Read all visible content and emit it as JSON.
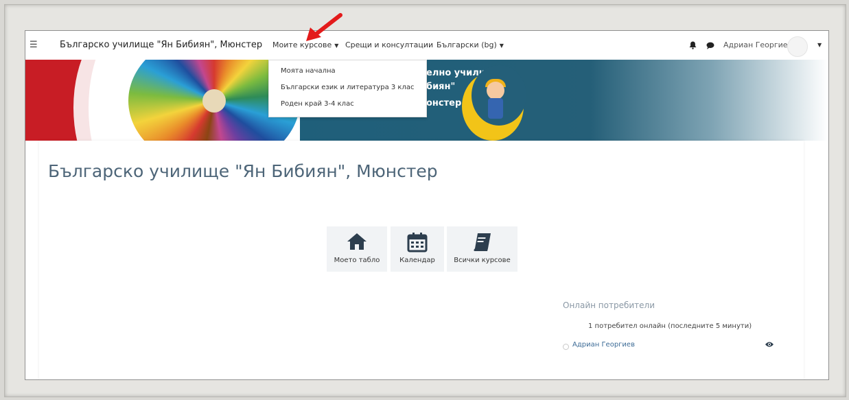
{
  "navbar": {
    "brand": "Българско училище \"Ян Бибиян\", Мюнстер",
    "menu_courses": "Моите курсове",
    "menu_meetings": "Срещи и консултации",
    "menu_language": "Български (bg)",
    "user_name": "Адриан Георгиев"
  },
  "dropdown": {
    "items": [
      "Моята начална",
      "Български език и литература 3 клас",
      "Роден край 3-4 клас"
    ]
  },
  "banner": {
    "line1": "елно училище",
    "line2": "биян\"",
    "line3": "онстер"
  },
  "main": {
    "title": "Българско училище \"Ян Бибиян\", Мюнстер",
    "tiles": [
      {
        "label": "Моето табло",
        "icon": "home-icon"
      },
      {
        "label": "Календар",
        "icon": "calendar-icon"
      },
      {
        "label": "Всички курсове",
        "icon": "book-icon"
      }
    ]
  },
  "online_users": {
    "title": "Онлайн потребители",
    "count_text": "1 потребител онлайн (последните 5 минути)",
    "users": [
      "Адриан Георгиев"
    ]
  },
  "colors": {
    "accent_red": "#c81d25",
    "banner_blue": "#1f5f7a",
    "title_color": "#4d6578",
    "link_color": "#3c6b96"
  }
}
